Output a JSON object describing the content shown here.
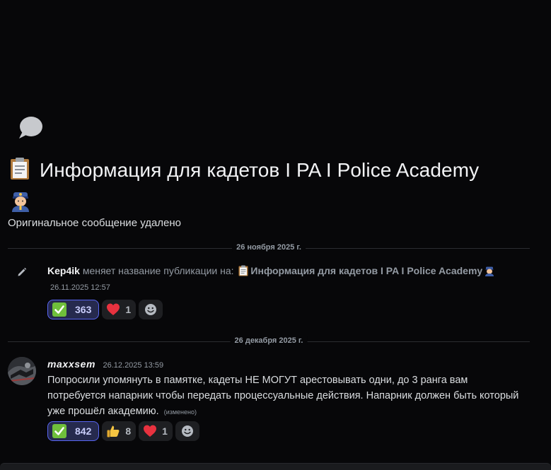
{
  "thread": {
    "icon": "speech-bubble-icon",
    "title_emoji": "clipboard-emoji",
    "title": "Информация для кадетов I PA I Police Academy",
    "title_trail_emoji": "police-officer-emoji",
    "deleted_notice": "Оригинальное сообщение удалено"
  },
  "dividers": {
    "first": "26 ноября 2025 г.",
    "second": "26 декабря 2025 г."
  },
  "system_message": {
    "icon": "pencil-icon",
    "user": "Kep4ik",
    "action": "меняет название публикации на:",
    "new_name": "Информация для кадетов I PA I Police Academy",
    "timestamp": "26.11.2025 12:57",
    "reactions": [
      {
        "emoji": "check-mark-button-emoji",
        "count": "363",
        "me": true
      },
      {
        "emoji": "red-heart-emoji",
        "count": "1",
        "me": false
      }
    ],
    "add_reaction_icon": "add-reaction-icon"
  },
  "message": {
    "author": "maxxsem",
    "timestamp": "26.12.2025 13:59",
    "text": "Попросили упомянуть в памятке, кадеты НЕ МОГУТ  арестовывать одни, до 3 ранга вам потребуется напарник чтобы передать процессуальные действия. Напарник должен быть который уже прошёл академию.",
    "edited_label": "(изменено)",
    "reactions": [
      {
        "emoji": "check-mark-button-emoji",
        "count": "842",
        "me": true
      },
      {
        "emoji": "thumbs-up-emoji",
        "count": "8",
        "me": false
      },
      {
        "emoji": "red-heart-emoji",
        "count": "1",
        "me": false
      }
    ],
    "add_reaction_icon": "add-reaction-icon"
  },
  "colors": {
    "background": "#070709",
    "accent": "#5865f2",
    "check_green": "#6fbf3b",
    "heart_red": "#e8323f"
  }
}
